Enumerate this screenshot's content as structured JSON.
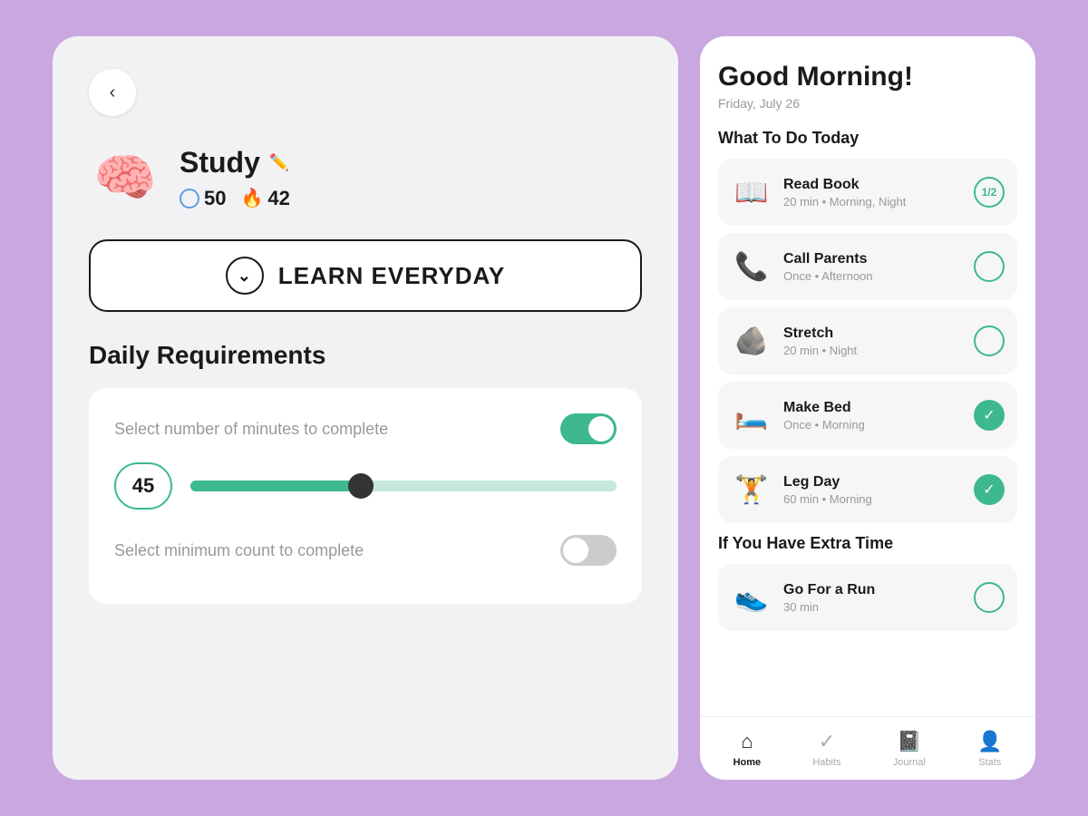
{
  "left": {
    "back_label": "‹",
    "habit_name": "Study",
    "habit_icon": "🧠",
    "edit_icon": "✏️",
    "stat_count": "50",
    "streak_count": "42",
    "learn_btn_label": "LEARN EVERYDAY",
    "daily_req_title": "Daily Requirements",
    "req1_label": "Select number of minutes to complete",
    "req2_label": "Select minimum count to complete",
    "slider_value": "45"
  },
  "right": {
    "greeting": "Good Morning!",
    "date": "Friday, July 26",
    "section_today": "What To Do Today",
    "section_extra": "If You Have Extra Time",
    "habits": [
      {
        "name": "Read Book",
        "meta": "20 min  •  Morning, Night",
        "icon": "📖",
        "status": "partial",
        "partial_label": "1/2"
      },
      {
        "name": "Call Parents",
        "meta": "Once  •  Afternoon",
        "icon": "📞",
        "status": "empty"
      },
      {
        "name": "Stretch",
        "meta": "20 min  •  Night",
        "icon": "🪨",
        "status": "empty"
      },
      {
        "name": "Make Bed",
        "meta": "Once  •  Morning",
        "icon": "🛏️",
        "status": "done"
      },
      {
        "name": "Leg Day",
        "meta": "60 min  •  Morning",
        "icon": "🏋️",
        "status": "done"
      }
    ],
    "extra_habits": [
      {
        "name": "Go For a Run",
        "meta": "30 min",
        "icon": "👟",
        "status": "empty"
      }
    ],
    "nav": [
      {
        "label": "Home",
        "icon": "⌂",
        "active": true
      },
      {
        "label": "Habits",
        "icon": "✓",
        "active": false
      },
      {
        "label": "Journal",
        "icon": "📓",
        "active": false
      },
      {
        "label": "Stats",
        "icon": "👤",
        "active": false
      }
    ]
  }
}
